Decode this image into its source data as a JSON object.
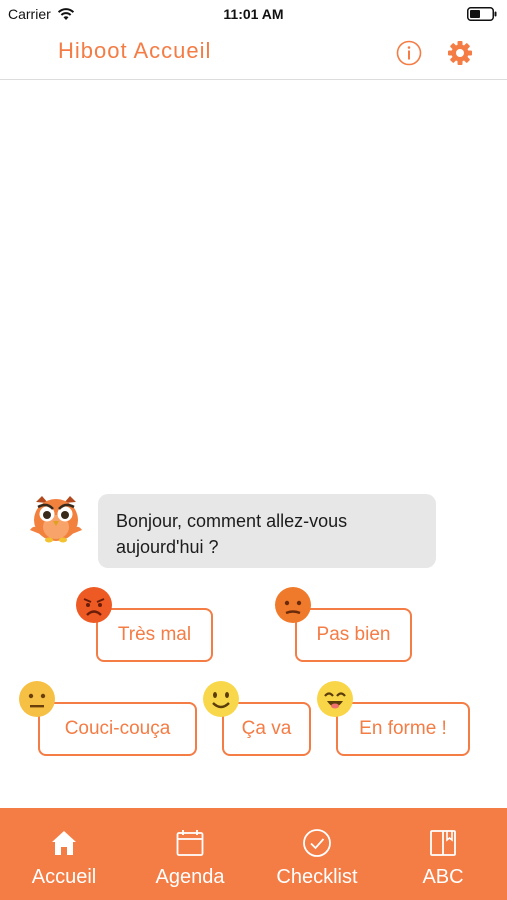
{
  "status_bar": {
    "carrier": "Carrier",
    "time": "11:01 AM"
  },
  "nav": {
    "title": "Hiboot Accueil",
    "info_icon": "info-icon",
    "settings_icon": "gear-icon"
  },
  "chat": {
    "message": "Bonjour, comment allez-vous aujourd'hui ?",
    "moods": [
      {
        "label": "Très mal",
        "icon": "angry-face-icon"
      },
      {
        "label": "Pas bien",
        "icon": "sad-face-icon"
      },
      {
        "label": "Couci-couça",
        "icon": "neutral-face-icon"
      },
      {
        "label": "Ça va",
        "icon": "smile-face-icon"
      },
      {
        "label": "En forme !",
        "icon": "happy-face-icon"
      }
    ]
  },
  "tabs": [
    {
      "label": "Accueil",
      "icon": "home-icon"
    },
    {
      "label": "Agenda",
      "icon": "calendar-icon"
    },
    {
      "label": "Checklist",
      "icon": "check-circle-icon"
    },
    {
      "label": "ABC",
      "icon": "book-icon"
    }
  ],
  "colors": {
    "accent": "#f47c45",
    "bubble": "#e7e7e7",
    "tab_text": "#ffffff"
  }
}
